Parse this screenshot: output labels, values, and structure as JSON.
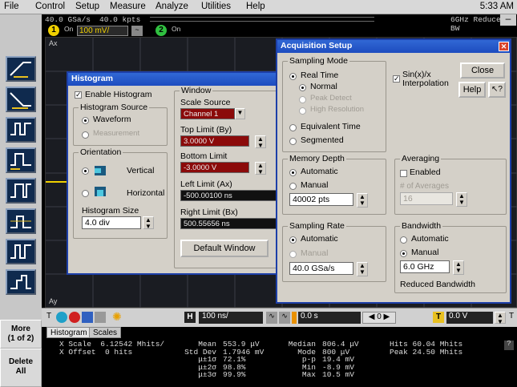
{
  "menubar": {
    "items": [
      "File",
      "Control",
      "Setup",
      "Measure",
      "Analyze",
      "Utilities",
      "Help"
    ],
    "clock": "5:33 AM"
  },
  "topinfo": {
    "sample_rate": "40.0 GSa/s",
    "points": "40.0 kpts",
    "bandwidth": "6GHz Reduced BW",
    "ch1_on": "On",
    "ch1_scale": "100 mV/",
    "ch2_on": "On"
  },
  "lefttoolbar": {
    "more_label": "More\n(1 of 2)",
    "delete_label": "Delete\nAll"
  },
  "graticule": {
    "ax_label": "Ax",
    "ay_label": "Ay"
  },
  "bottombar": {
    "timebase": "100 ns/",
    "delay": "0.0 s",
    "nav": "0",
    "trigger_level": "0.0 V",
    "t_label": "T",
    "h_label": "H"
  },
  "tabs": [
    "Histogram",
    "Scales"
  ],
  "measurements": {
    "col1": "X Scale  6.12542 Mhits/\nX Offset  0 hits",
    "col2_labels": "Mean\nStd Dev\nμ±1σ\nμ±2σ\nμ±3σ",
    "col2_values": "553.9 μV\n1.7946 mV\n72.1%\n98.8%\n99.9%",
    "col3_labels": "Median\nMode\np-p\nMin\nMax",
    "col3_values": "806.4 μV\n800 μV\n19.4 mV\n-8.9 mV\n10.5 mV",
    "col4": "Hits 60.04 Mhits\nPeak 24.50 Mhits",
    "help": "?"
  },
  "histogram_dialog": {
    "title": "Histogram",
    "enable_label": "Enable Histogram",
    "source_group": "Histogram Source",
    "waveform": "Waveform",
    "measurement": "Measurement",
    "orientation_group": "Orientation",
    "vertical": "Vertical",
    "horizontal": "Horizontal",
    "size_label": "Histogram Size",
    "size_value": "4.0 div",
    "window_group": "Window",
    "scale_source_label": "Scale Source",
    "scale_source_value": "Channel 1",
    "top_limit_label": "Top Limit (By)",
    "top_limit_value": "3.0000 V",
    "bottom_limit_label": "Bottom Limit",
    "bottom_limit_value": "-3.0000 V",
    "left_limit_label": "Left Limit (Ax)",
    "left_limit_value": "-500.00100 ns",
    "right_limit_label": "Right Limit (Bx)",
    "right_limit_value": "500.55656 ns",
    "default_window": "Default Window"
  },
  "acq_dialog": {
    "title": "Acquisition Setup",
    "sampling_mode_group": "Sampling Mode",
    "real_time": "Real Time",
    "normal": "Normal",
    "peak_detect": "Peak Detect",
    "high_res": "High Resolution",
    "equiv_time": "Equivalent Time",
    "segmented": "Segmented",
    "sinx_label": "Sin(x)/x\nInterpolation",
    "close": "Close",
    "help": "Help",
    "help_arrow": "↖?",
    "memory_group": "Memory Depth",
    "automatic": "Automatic",
    "manual": "Manual",
    "memory_value": "40002 pts",
    "averaging_group": "Averaging",
    "enabled": "Enabled",
    "num_avg_label": "# of Averages",
    "num_avg_value": "16",
    "sampling_rate_group": "Sampling Rate",
    "sr_automatic": "Automatic",
    "sr_manual": "Manual",
    "sr_value": "40.0 GSa/s",
    "bandwidth_group": "Bandwidth",
    "bw_automatic": "Automatic",
    "bw_manual": "Manual",
    "bw_value": "6.0 GHz",
    "reduced_bw": "Reduced Bandwidth"
  },
  "colors": {
    "title_blue": "#1d4cbf",
    "ch1_yellow": "#f0d000",
    "ch2_green": "#30c040",
    "toolbar_navy": "#0f2a4e"
  }
}
